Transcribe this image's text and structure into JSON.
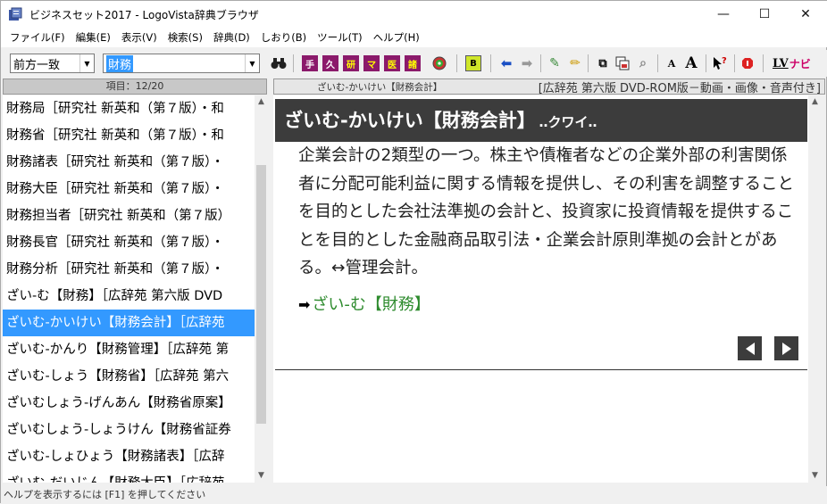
{
  "window": {
    "title": "ビジネスセット2017 - LogoVista辞典ブラウザ",
    "minimize_glyph": "—",
    "maximize_glyph": "☐",
    "close_glyph": "✕"
  },
  "menu": [
    "ファイル(F)",
    "編集(E)",
    "表示(V)",
    "検索(S)",
    "辞典(D)",
    "しおり(B)",
    "ツール(T)",
    "ヘルプ(H)"
  ],
  "toolbar": {
    "mode_value": "前方一致",
    "search_value": "財務",
    "binoculars_icon": "binoculars-icon",
    "dict_buttons": [
      "手",
      "久",
      "研",
      "マ",
      "医",
      "諸"
    ],
    "b_button": "B",
    "font_small": "A",
    "font_large": "A",
    "lv_label": "LV",
    "navi_label": "ナビ"
  },
  "left_pane": {
    "header": "項目：12/20",
    "items": [
      "財務局［研究社 新英和（第７版）・和",
      "財務省［研究社 新英和（第７版）・和",
      "財務諸表［研究社 新英和（第７版）・",
      "財務大臣［研究社 新英和（第７版）・",
      "財務担当者［研究社 新英和（第７版）",
      "財務長官［研究社 新英和（第７版）・",
      "財務分析［研究社 新英和（第７版）・",
      "ざい-む【財務】［広辞苑 第六版 DVD",
      "ざいむ-かいけい【財務会計】［広辞苑",
      "ざいむ-かんり【財務管理】［広辞苑 第",
      "ざいむ-しょう【財務省】［広辞苑 第六",
      "ざいむしょう-げんあん【財務省原案】",
      "ざいむしょう-しょうけん【財務省証券",
      "ざいむ-しょひょう【財務諸表】［広辞",
      "ざいむ-だいじん【財務大臣】［広辞苑"
    ],
    "selected_index": 8
  },
  "right_pane": {
    "entry_label": "ざいむ-かいけい【財務会計】",
    "dict_label": "[広辞苑 第六版 DVD-ROM版－動画・画像・音声付き]",
    "headword": "ざいむ-かいけい【財務会計】",
    "reading": "‥クワイ‥",
    "body": "企業会計の2類型の一つ。株主や債権者などの企業外部の利害関係者に分配可能利益に関する情報を提供し、その利害を調整することを目的とした会社法準拠の会計と、投資家に投資情報を提供することを目的とした金融商品取引法・企業会計原則準拠の会計とがある。↔管理会計。",
    "xref_mark": "➡",
    "xref": "ざい-む【財務】"
  },
  "status": "ヘルプを表示するには [F1] を押してください",
  "colors": {
    "selection": "#3399ff",
    "headword_bg": "#3c3c3c",
    "xref": "#2e8b2e"
  }
}
